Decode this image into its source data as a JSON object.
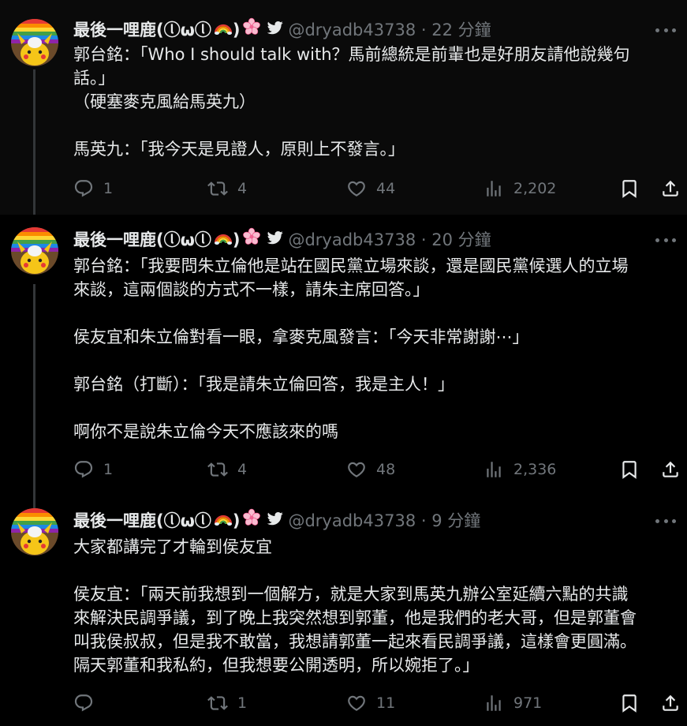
{
  "tweets": [
    {
      "author_name": "最後一哩鹿(ⓛωⓛ",
      "author_close": ")",
      "handle_time": "@dryadb43738 · 22 分鐘",
      "text": "郭台銘：「Who I should talk with？馬前總統是前輩也是好朋友請他說幾句\n話。」\n（硬塞麥克風給馬英九）\n\n馬英九：「我今天是見證人，原則上不發言。」",
      "replies": "1",
      "reposts": "4",
      "likes": "44",
      "views": "2,202"
    },
    {
      "author_name": "最後一哩鹿(ⓛωⓛ",
      "author_close": ")",
      "handle_time": "@dryadb43738 · 20 分鐘",
      "text": "郭台銘：「我要問朱立倫他是站在國民黨立場來談，還是國民黨候選人的立場\n來談，這兩個談的方式不一樣，請朱主席回答。」\n\n侯友宜和朱立倫對看一眼，拿麥克風發言：「今天非常謝謝⋯」\n\n郭台銘（打斷）：「我是請朱立倫回答，我是主人！」\n\n啊你不是說朱立倫今天不應該來的嗎",
      "replies": "1",
      "reposts": "4",
      "likes": "48",
      "views": "2,336"
    },
    {
      "author_name": "最後一哩鹿(ⓛωⓛ",
      "author_close": ")",
      "handle_time": "@dryadb43738 · 9 分鐘",
      "text": "大家都講完了才輪到侯友宜\n\n侯友宜：「兩天前我想到一個解方，就是大家到馬英九辦公室延續六點的共識\n來解決民調爭議，到了晚上我突然想到郭董，他是我們的老大哥，但是郭董會\n叫我侯叔叔，但是我不敢當，我想請郭董一起來看民調爭議，這樣會更圓滿。\n隔天郭董和我私約，但我想要公開透明，所以婉拒了。」",
      "replies": "",
      "reposts": "1",
      "likes": "11",
      "views": "971"
    }
  ],
  "icons": {
    "rainbow": "rainbow-emoji",
    "flower": "cherry-blossom-emoji",
    "bird": "twitter-bird-icon",
    "more": "more-icon",
    "reply": "reply-icon",
    "repost": "repost-icon",
    "like": "like-icon",
    "views": "views-icon",
    "bookmark": "bookmark-icon",
    "share": "share-icon"
  },
  "colors": {
    "background": "#000000",
    "text": "#e7e9ea",
    "secondary": "#71767b",
    "thread_line": "#333639"
  }
}
